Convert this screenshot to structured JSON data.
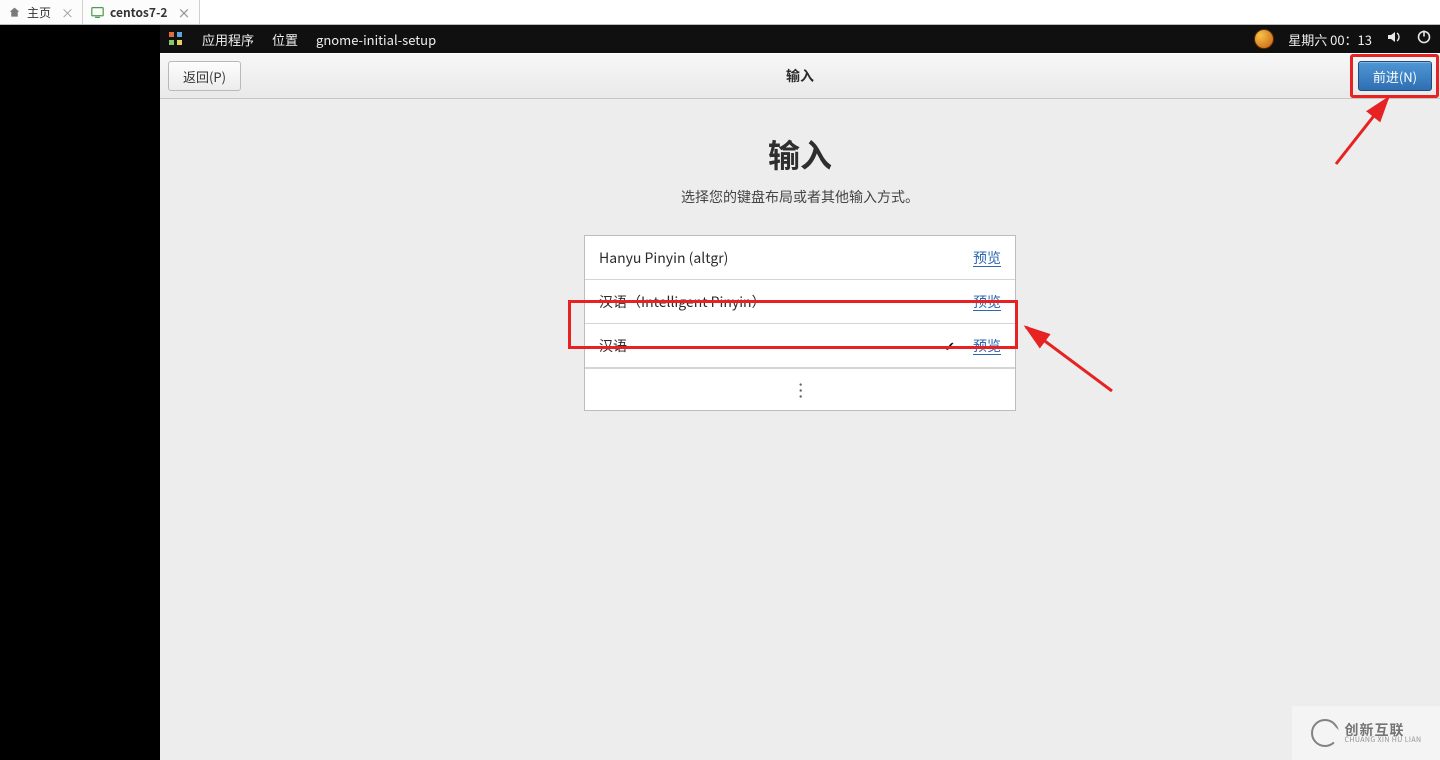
{
  "host_tabs": [
    {
      "label": "主页"
    },
    {
      "label": "centos7-2"
    }
  ],
  "gnome_top": {
    "apps": "应用程序",
    "places": "位置",
    "process": "gnome-initial-setup",
    "clock": "星期六 00：13"
  },
  "dialog": {
    "back": "返回(P)",
    "next": "前进(N)",
    "title_small": "输入",
    "title_big": "输入",
    "subtitle": "选择您的键盘布局或者其他输入方式。"
  },
  "rows": [
    {
      "name": "Hanyu Pinyin (altgr)",
      "preview": "预览",
      "selected": false
    },
    {
      "name": "汉语（Intelligent Pinyin）",
      "preview": "预览",
      "selected": false
    },
    {
      "name": "汉语",
      "preview": "预览",
      "selected": true
    }
  ],
  "watermark": {
    "cn": "创新互联",
    "en": "CHUANG XIN HU LIAN"
  }
}
